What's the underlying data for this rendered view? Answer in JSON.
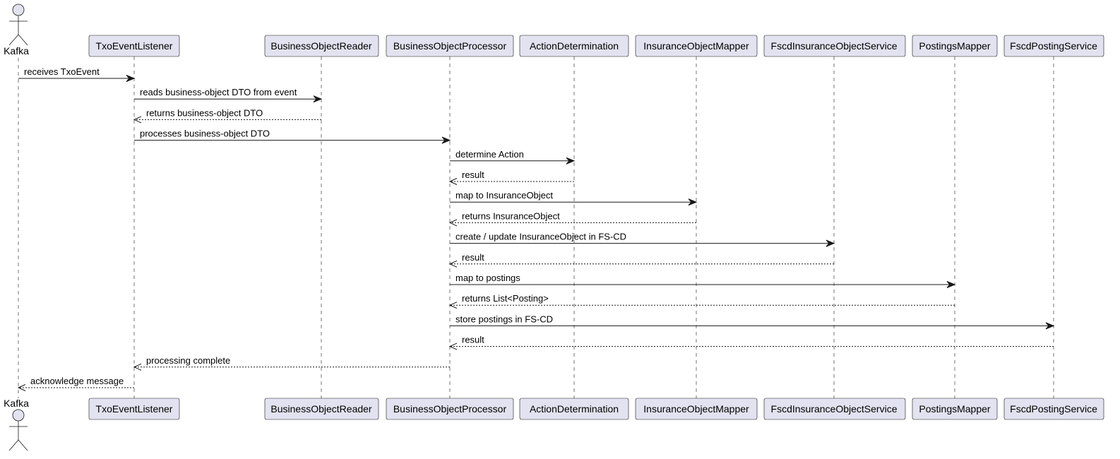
{
  "actor": {
    "name": "Kafka",
    "icon": "stick-figure-actor-icon"
  },
  "participants": [
    {
      "id": "txo",
      "label": "TxoEventListener"
    },
    {
      "id": "bor",
      "label": "BusinessObjectReader"
    },
    {
      "id": "bop",
      "label": "BusinessObjectProcessor"
    },
    {
      "id": "ad",
      "label": "ActionDetermination"
    },
    {
      "id": "iom",
      "label": "InsuranceObjectMapper"
    },
    {
      "id": "fios",
      "label": "FscdInsuranceObjectService"
    },
    {
      "id": "pm",
      "label": "PostingsMapper"
    },
    {
      "id": "fps",
      "label": "FscdPostingService"
    }
  ],
  "messages": [
    {
      "from": "kafka",
      "to": "txo",
      "label": "receives TxoEvent",
      "style": "solid"
    },
    {
      "from": "txo",
      "to": "bor",
      "label": "reads business-object DTO from event",
      "style": "solid"
    },
    {
      "from": "bor",
      "to": "txo",
      "label": "returns business-object DTO",
      "style": "dashed"
    },
    {
      "from": "txo",
      "to": "bop",
      "label": "processes business-object DTO",
      "style": "solid"
    },
    {
      "from": "bop",
      "to": "ad",
      "label": "determine Action",
      "style": "solid"
    },
    {
      "from": "ad",
      "to": "bop",
      "label": "result",
      "style": "dashed"
    },
    {
      "from": "bop",
      "to": "iom",
      "label": "map to InsuranceObject",
      "style": "solid"
    },
    {
      "from": "iom",
      "to": "bop",
      "label": "returns InsuranceObject",
      "style": "dashed"
    },
    {
      "from": "bop",
      "to": "fios",
      "label": "create / update InsuranceObject in FS-CD",
      "style": "solid"
    },
    {
      "from": "fios",
      "to": "bop",
      "label": "result",
      "style": "dashed"
    },
    {
      "from": "bop",
      "to": "pm",
      "label": "map to postings",
      "style": "solid"
    },
    {
      "from": "pm",
      "to": "bop",
      "label": "returns List<Posting>",
      "style": "dashed"
    },
    {
      "from": "bop",
      "to": "fps",
      "label": "store postings in FS-CD",
      "style": "solid"
    },
    {
      "from": "fps",
      "to": "bop",
      "label": "result",
      "style": "dashed"
    },
    {
      "from": "bop",
      "to": "txo",
      "label": "processing complete",
      "style": "dashed"
    },
    {
      "from": "txo",
      "to": "kafka",
      "label": "acknowledge message",
      "style": "dashed"
    }
  ],
  "colors": {
    "participant_fill": "#e2e2f0",
    "line": "#181818"
  }
}
